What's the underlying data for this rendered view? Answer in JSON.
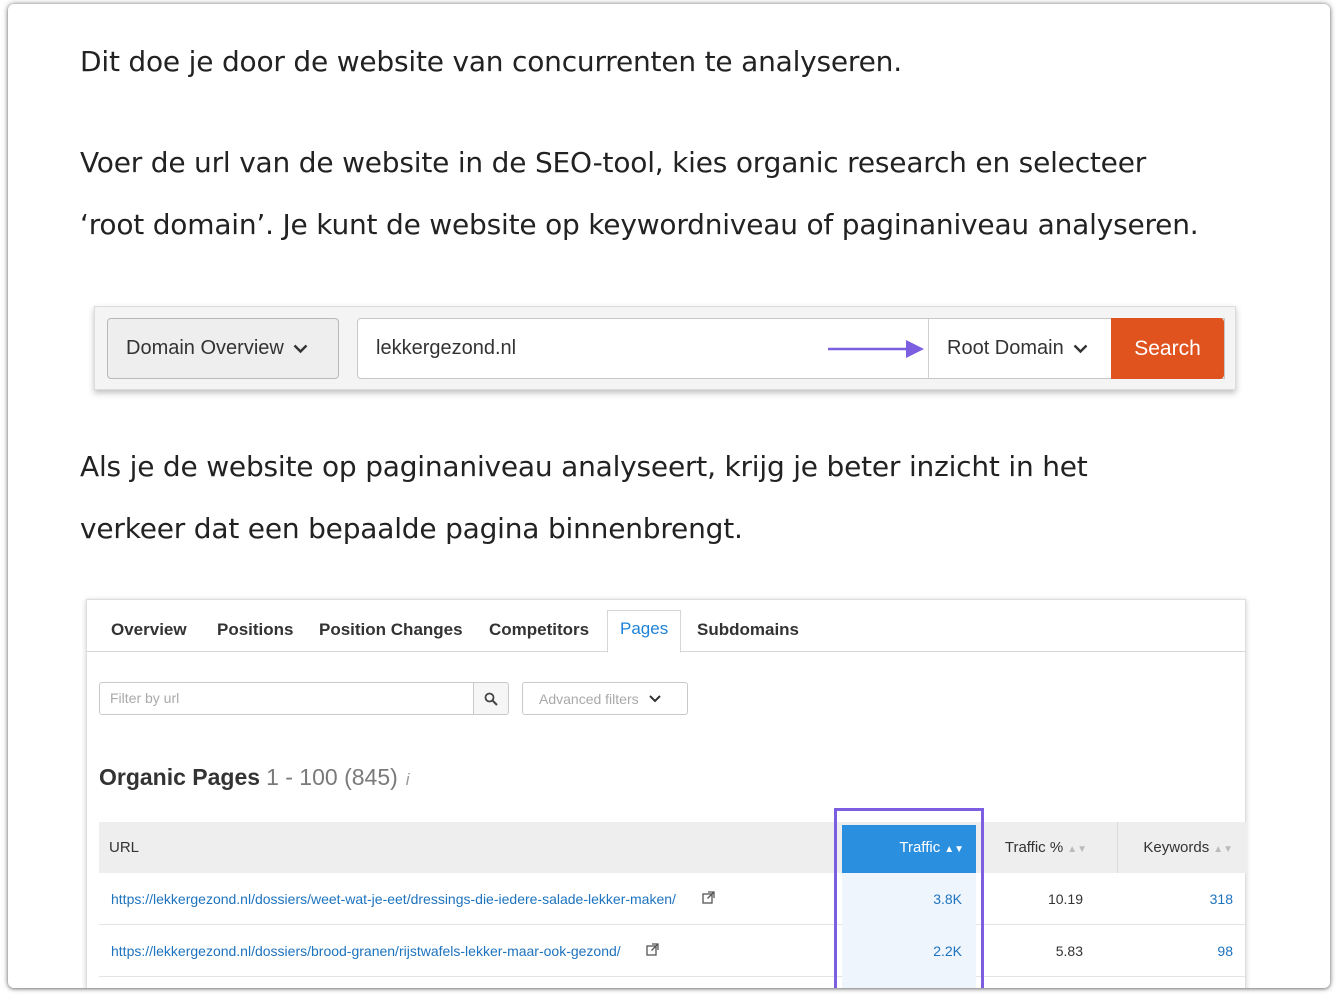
{
  "paragraphs": {
    "p1": "Dit doe je door de website van concurrenten te analyseren.",
    "p2_line1": "Voer de url van de website in de SEO-tool, kies organic research en selecteer",
    "p2_line2": "‘root domain’. Je kunt de website op keywordniveau of paginaniveau analyseren.",
    "p3_line1": "Als je de website op paginaniveau analyseert, krijg je beter inzicht in het",
    "p3_line2": "verkeer dat een bepaalde pagina binnenbrengt."
  },
  "searchbar": {
    "domain_select": "Domain Overview",
    "url_value": "lekkergezond.nl",
    "root_select": "Root Domain",
    "search_label": "Search",
    "accent": "#e0531f",
    "arrow_color": "#7b5fe0"
  },
  "panel": {
    "tabs": [
      {
        "label": "Overview",
        "active": false
      },
      {
        "label": "Positions",
        "active": false
      },
      {
        "label": "Position Changes",
        "active": false
      },
      {
        "label": "Competitors",
        "active": false
      },
      {
        "label": "Pages",
        "active": true
      },
      {
        "label": "Subdomains",
        "active": false
      }
    ],
    "filter_placeholder": "Filter by url",
    "advanced_filters": "Advanced filters",
    "title": "Organic Pages",
    "range": "1 - 100 (845)",
    "info": "i",
    "columns": {
      "url": "URL",
      "traffic": "Traffic",
      "traffic_pct": "Traffic %",
      "keywords": "Keywords"
    },
    "rows": [
      {
        "url": "https://lekkergezond.nl/dossiers/weet-wat-je-eet/dressings-die-iedere-salade-lekker-maken/",
        "traffic": "3.8K",
        "traffic_pct": "10.19",
        "keywords": "318"
      },
      {
        "url": "https://lekkergezond.nl/dossiers/brood-granen/rijstwafels-lekker-maar-ook-gezond/",
        "traffic": "2.2K",
        "traffic_pct": "5.83",
        "keywords": "98"
      }
    ],
    "header_accent": "#2b8fe0",
    "highlight_color": "#7b5fe0"
  }
}
